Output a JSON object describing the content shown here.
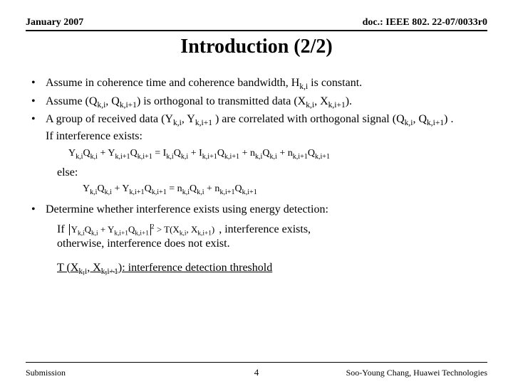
{
  "header": {
    "left": "January 2007",
    "right": "doc.: IEEE 802. 22-07/0033r0"
  },
  "title": "Introduction (2/2)",
  "bullets": [
    {
      "text_html": "Assume in coherence time and coherence bandwidth, H<sub>k,i</sub> is constant."
    },
    {
      "text_html": "Assume (Q<sub>k,i</sub>, Q<sub>k,i+1</sub>) is orthogonal to transmitted data (X<sub>k,i</sub>, X<sub>k,i+1</sub>)."
    },
    {
      "text_html": "A group of received data (Y<sub>k,i</sub>, Y<sub>k,i+1</sub> ) are correlated with orthogonal signal (Q<sub>k,i</sub>, Q<sub>k,i+1</sub>) .",
      "tail": "If interference exists:"
    }
  ],
  "eq1_html": "Y<sub>k,i</sub>Q<sub>k,i</sub> + Y<sub>k,i+1</sub>Q<sub>k,i+1</sub> = I<sub>k,i</sub>Q<sub>k,i</sub> + I<sub>k,i+1</sub>Q<sub>k,i+1</sub> + n<sub>k,i</sub>Q<sub>k,i</sub> + n<sub>k,i+1</sub>Q<sub>k,i+1</sub>",
  "else_label": "else:",
  "eq2_html": "Y<sub>k,i</sub>Q<sub>k,i</sub> + Y<sub>k,i+1</sub>Q<sub>k,i+1</sub> = n<sub>k,i</sub>Q<sub>k,i</sub> + n<sub>k,i+1</sub>Q<sub>k,i+1</sub>",
  "bullet4_text": "Determine whether interference exists using energy detection:",
  "if_label": "If",
  "if_eq_html": "<span class=\"abs-bar\">Y<sub>k,i</sub>Q<sub>k,i</sub> + Y<sub>k,i+1</sub>Q<sub>k,i+1</sub></span><sup>2</sup> &gt; T(X<sub>k,i</sub>, X<sub>k,i+1</sub>)",
  "if_tail": ", interference exists,",
  "otherwise": "otherwise, interference does not exist.",
  "threshold_html": "T (X<sub>k,i</sub>, X<sub>k,i+1</sub>): interference detection threshold",
  "footer": {
    "left": "Submission",
    "center": "4",
    "right": "Soo-Young Chang, Huawei Technologies"
  }
}
